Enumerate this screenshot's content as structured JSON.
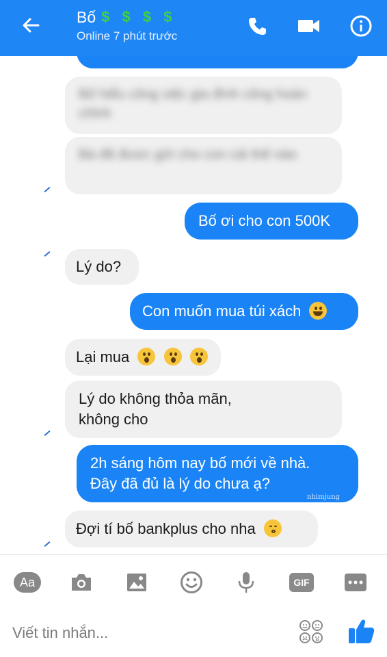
{
  "header": {
    "title": "Bố",
    "dollars": "$ $ $ $",
    "status": "Online 7 phút trước",
    "colors": {
      "bar": "#1f86f5",
      "dollar": "#3fd23f"
    },
    "icons": [
      "back-arrow-icon",
      "phone-icon",
      "video-camera-icon",
      "info-icon"
    ]
  },
  "messages": [
    {
      "id": "m1",
      "side": "in",
      "blurred": true,
      "text": "Bố hiểu công việc gia đình công hoàn chỉnh"
    },
    {
      "id": "m2",
      "side": "in",
      "blurred": true,
      "text": "Bà đã được gửi cho con cái thế nào"
    },
    {
      "id": "m3",
      "side": "out",
      "text": "Bố ơi cho con 500K"
    },
    {
      "id": "m4",
      "side": "in",
      "text": "Lý do?"
    },
    {
      "id": "m5",
      "side": "out",
      "text": "Con muốn mua túi xách",
      "emoji": "grinning-emoji"
    },
    {
      "id": "m6",
      "side": "in",
      "text": "Lại mua",
      "emoji": "surprised-emoji"
    },
    {
      "id": "m7",
      "side": "in",
      "line1": "Lý do không thỏa mãn,",
      "line2": "không cho"
    },
    {
      "id": "m8",
      "side": "out",
      "line1": "2h sáng hôm nay bố mới về nhà.",
      "line2": "Đây đã đủ là lý do chưa ạ?"
    },
    {
      "id": "m9",
      "side": "in",
      "text": "Đợi tí bố bankplus cho nha",
      "emoji": "kissing-emoji"
    }
  ],
  "watermark": "nhimjung",
  "toolbar": {
    "aa_label": "Aa",
    "gif_label": "GIF",
    "icons": [
      "camera-icon",
      "image-icon",
      "smiley-icon",
      "microphone-icon",
      "more-icon"
    ]
  },
  "composer": {
    "placeholder": "Viết tin nhắn...",
    "icons": [
      "emoji-grid-icon",
      "thumbs-up-icon"
    ],
    "accent": "#1a84f7"
  }
}
